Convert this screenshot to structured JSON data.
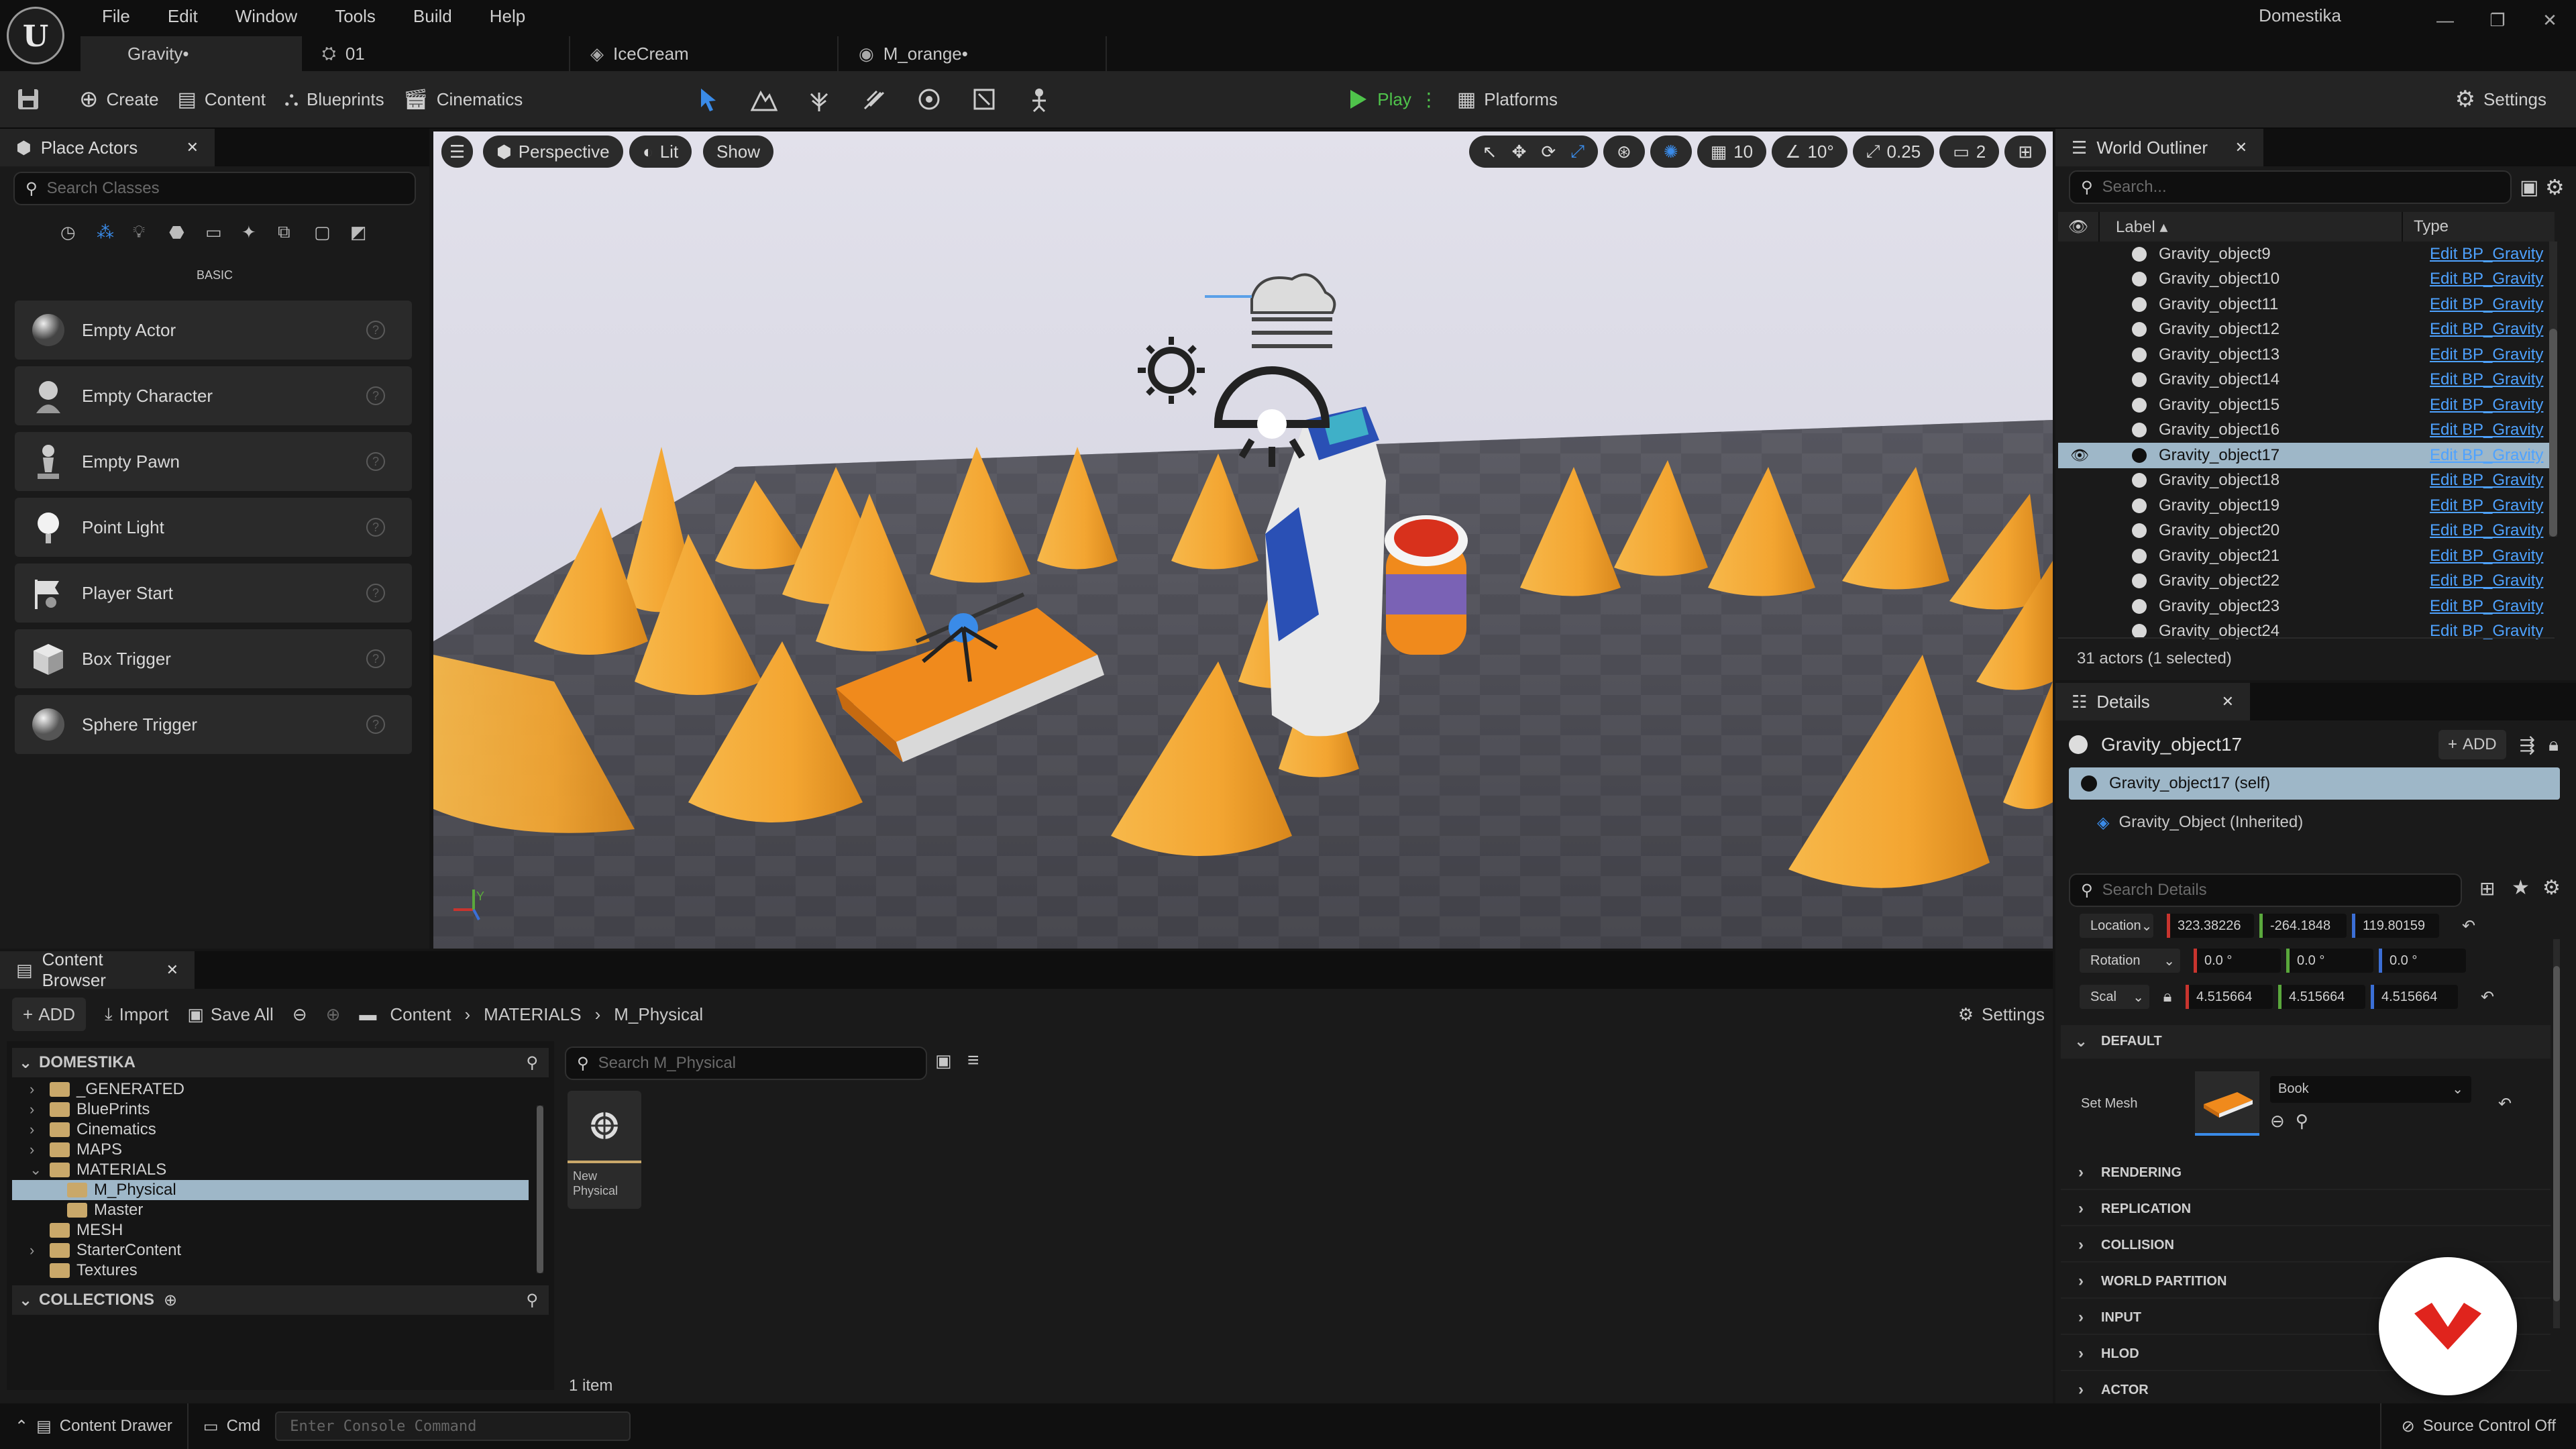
{
  "menu": [
    "File",
    "Edit",
    "Window",
    "Tools",
    "Build",
    "Help"
  ],
  "app_title": "Domestika",
  "doc_tabs": [
    "Gravity•",
    "01",
    "IceCream",
    "M_orange•"
  ],
  "toolbar": {
    "create": "Create",
    "content": "Content",
    "blueprints": "Blueprints",
    "cinematics": "Cinematics",
    "play": "Play",
    "platforms": "Platforms",
    "settings": "Settings"
  },
  "place_actors": {
    "tab": "Place Actors",
    "search_placeholder": "Search Classes",
    "category": "BASIC",
    "items": [
      "Empty Actor",
      "Empty Character",
      "Empty Pawn",
      "Point Light",
      "Player Start",
      "Box Trigger",
      "Sphere Trigger"
    ]
  },
  "viewport": {
    "perspective": "Perspective",
    "lit": "Lit",
    "show": "Show",
    "grid": "10",
    "angle": "10°",
    "scale": "0.25",
    "camera": "2"
  },
  "outliner": {
    "tab": "World Outliner",
    "search_placeholder": "Search...",
    "col_label": "Label",
    "col_type": "Type",
    "rows": [
      "Gravity_object9",
      "Gravity_object10",
      "Gravity_object11",
      "Gravity_object12",
      "Gravity_object13",
      "Gravity_object14",
      "Gravity_object15",
      "Gravity_object16",
      "Gravity_object17",
      "Gravity_object18",
      "Gravity_object19",
      "Gravity_object20",
      "Gravity_object21",
      "Gravity_object22",
      "Gravity_object23",
      "Gravity_object24"
    ],
    "type_text": "Edit BP_Gravity",
    "selected": "Gravity_object17",
    "status": "31 actors (1 selected)"
  },
  "details": {
    "tab": "Details",
    "object_name": "Gravity_object17",
    "add": "ADD",
    "self": "Gravity_object17 (self)",
    "inherited": "Gravity_Object (Inherited)",
    "search_placeholder": "Search Details",
    "location_label": "Location",
    "location": [
      "323.38226",
      "-264.1848",
      "119.80159"
    ],
    "rotation_label": "Rotation",
    "rotation": [
      "0.0 °",
      "0.0 °",
      "0.0 °"
    ],
    "scale_label": "Scal",
    "scale": [
      "4.515664",
      "4.515664",
      "4.515664"
    ],
    "default_section": "DEFAULT",
    "set_mesh_label": "Set Mesh",
    "mesh_value": "Book",
    "sections": [
      "RENDERING",
      "REPLICATION",
      "COLLISION",
      "WORLD PARTITION",
      "INPUT",
      "HLOD",
      "ACTOR"
    ]
  },
  "content_browser": {
    "tab": "Content Browser",
    "add": "ADD",
    "import": "Import",
    "save_all": "Save All",
    "path": [
      "Content",
      "MATERIALS",
      "M_Physical"
    ],
    "settings": "Settings",
    "root": "DOMESTIKA",
    "tree": [
      "_GENERATED",
      "BluePrints",
      "Cinematics",
      "MAPS",
      "MATERIALS",
      "M_Physical",
      "Master",
      "MESH",
      "StarterContent",
      "Textures"
    ],
    "collections": "COLLECTIONS",
    "search_placeholder": "Search M_Physical",
    "asset_label": "New Physical",
    "item_count": "1 item"
  },
  "statusbar": {
    "drawer": "Content Drawer",
    "cmd": "Cmd",
    "console_placeholder": "Enter Console Command",
    "source_control": "Source Control Off"
  },
  "colors": {
    "accent_play": "#4fc34b",
    "link": "#4ea2ff",
    "selection": "#9eb7c8",
    "cone": "#f3a531",
    "domestika_red": "#e0241d"
  }
}
